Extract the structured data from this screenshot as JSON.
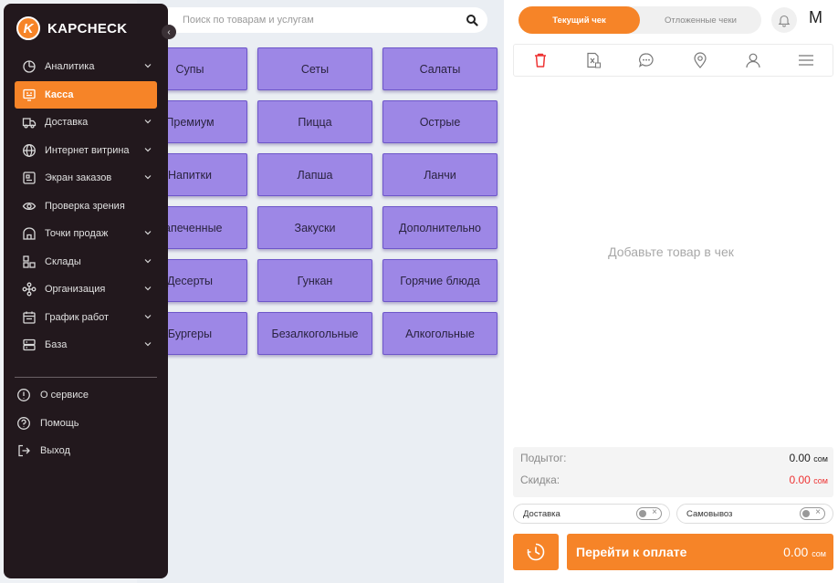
{
  "search": {
    "placeholder": "Поиск по товарам и услугам"
  },
  "categories": [
    "Супы",
    "Сеты",
    "Салаты",
    "Премиум",
    "Пицца",
    "Острые",
    "Напитки",
    "Лапша",
    "Ланчи",
    "Запеченные",
    "Закуски",
    "Дополнительно",
    "Десерты",
    "Гункан",
    "Горячие блюда",
    "Бургеры",
    "Безалкогольные",
    "Алкогольные"
  ],
  "receipt": {
    "tabs": [
      "Текущий чек",
      "Отложенные чеки"
    ],
    "user_initial": "M",
    "empty_message": "Добавьте товар в чек",
    "subtotal_label": "Подытог:",
    "subtotal_value": "0.00",
    "discount_label": "Скидка:",
    "discount_value": "0.00",
    "currency": "сом",
    "delivery_label": "Доставка",
    "pickup_label": "Самовывоз",
    "pay_label": "Перейти к оплате",
    "pay_value": "0.00"
  },
  "sidebar": {
    "brand": "KAPCHECK",
    "logo_letter": "K",
    "items": [
      {
        "label": "Аналитика",
        "icon": "analytics-icon",
        "chevron": true
      },
      {
        "label": "Касса",
        "icon": "cash-register-icon",
        "chevron": false,
        "active": true
      },
      {
        "label": "Доставка",
        "icon": "truck-icon",
        "chevron": true
      },
      {
        "label": "Интернет витрина",
        "icon": "globe-icon",
        "chevron": true
      },
      {
        "label": "Экран заказов",
        "icon": "order-screen-icon",
        "chevron": true
      },
      {
        "label": "Проверка зрения",
        "icon": "eye-icon",
        "chevron": false
      },
      {
        "label": "Точки продаж",
        "icon": "store-icon",
        "chevron": true
      },
      {
        "label": "Склады",
        "icon": "warehouse-icon",
        "chevron": true
      },
      {
        "label": "Организация",
        "icon": "organization-icon",
        "chevron": true
      },
      {
        "label": "График работ",
        "icon": "calendar-icon",
        "chevron": true
      },
      {
        "label": "База",
        "icon": "database-icon",
        "chevron": true
      }
    ],
    "bottom_items": [
      {
        "label": "О сервисе",
        "icon": "info-icon"
      },
      {
        "label": "Помощь",
        "icon": "help-icon"
      },
      {
        "label": "Выход",
        "icon": "logout-icon"
      }
    ]
  },
  "colors": {
    "accent": "#f68428",
    "category": "#9d87e6",
    "sidebar": "#22181d",
    "discount": "#e33333"
  }
}
